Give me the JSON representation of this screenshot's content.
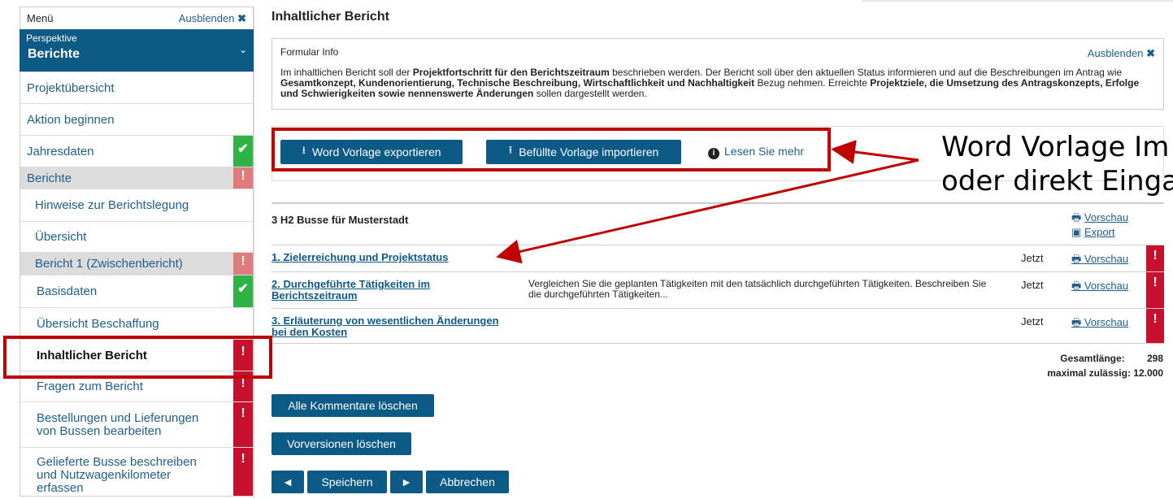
{
  "sidebar": {
    "menu_label": "Menü",
    "hide_label": "Ausblenden",
    "perspective_label": "Perspektive",
    "perspective_value": "Berichte",
    "items": [
      {
        "label": "Projektübersicht"
      },
      {
        "label": "Aktion beginnen"
      },
      {
        "label": "Jahresdaten"
      },
      {
        "label": "Berichte"
      },
      {
        "label": "Hinweise zur Berichtslegung"
      },
      {
        "label": "Übersicht"
      },
      {
        "label": "Bericht 1 (Zwischenbericht)"
      },
      {
        "label": "Basisdaten"
      },
      {
        "label": "Übersicht Beschaffung"
      },
      {
        "label": "Inhaltlicher Bericht"
      },
      {
        "label": "Fragen zum Bericht"
      },
      {
        "label": "Bestellungen und Lieferungen von Bussen bearbeiten"
      },
      {
        "label": "Gelieferte Busse beschreiben und Nutzwagenkilometer erfassen"
      }
    ]
  },
  "main": {
    "title": "Inhaltlicher Bericht",
    "info": {
      "title": "Formular Info",
      "hide_label": "Ausblenden",
      "t1": "Im inhaltlichen Bericht soll der ",
      "b1": "Projektfortschritt für den Berichtszeitraum",
      "t2": " beschrieben werden. Der Bericht soll über den aktuellen Status informieren und auf die Beschreibungen im Antrag wie ",
      "b2": "Gesamtkonzept, Kundenorientierung, Technische Beschreibung, Wirtschaftlichkeit und Nachhaltigkeit",
      "t3": " Bezug nehmen. Erreichte ",
      "b3": "Projektziele, die Umsetzung des Antragskonzepts, Erfolge und Schwierigkeiten sowie nennenswerte Änderungen",
      "t4": " sollen dargestellt werden."
    },
    "toolbar": {
      "export_label": "Word Vorlage exportieren",
      "import_label": "Befüllte Vorlage importieren",
      "readmore_label": "Lesen Sie mehr"
    },
    "project": {
      "name": "3 H2 Busse für Musterstadt",
      "preview_label": "Vorschau",
      "export_label": "Export"
    },
    "rows": [
      {
        "name": "1. Zielerreichung und Projektstatus",
        "desc": "",
        "when": "Jetzt",
        "preview": "Vorschau"
      },
      {
        "name": "2. Durchgeführte Tätigkeiten im Berichtszeitraum",
        "desc": "Vergleichen Sie die geplanten Tätigkeiten mit den tatsächlich durchgeführten Tätigkeiten. Beschreiben Sie die durchgeführten Tätigkeiten...",
        "when": "Jetzt",
        "preview": "Vorschau"
      },
      {
        "name": "3. Erläuterung von wesentlichen Änderungen bei den Kosten",
        "desc": "",
        "when": "Jetzt",
        "preview": "Vorschau"
      }
    ],
    "totals": {
      "length_label": "Gesamtlänge:",
      "length_value": "298",
      "max_label": "maximal zulässig: 12.000"
    },
    "buttons": {
      "delete_comments": "Alle Kommentare löschen",
      "delete_versions": "Vorversionen löschen",
      "prev": "◄",
      "save": "Speichern",
      "next": "►",
      "cancel": "Abbrechen"
    }
  },
  "annotation": {
    "line1": "Word Vorlage Im",
    "line2": "oder direkt Einga"
  },
  "colors": {
    "primary": "#0d5a87",
    "error": "#c8102e",
    "ok": "#2fb344",
    "highlight": "#c00000"
  }
}
